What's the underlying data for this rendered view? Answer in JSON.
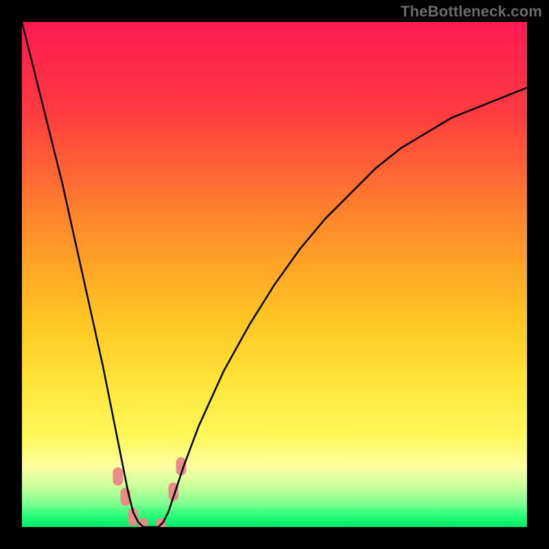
{
  "watermark": "TheBottleneck.com",
  "chart_data": {
    "type": "line",
    "title": "",
    "xlabel": "",
    "ylabel": "",
    "xlim": [
      0,
      100
    ],
    "ylim": [
      0,
      100
    ],
    "gradient_stops": [
      {
        "offset": 0,
        "color": "#ff1a54"
      },
      {
        "offset": 0.18,
        "color": "#ff3b3f"
      },
      {
        "offset": 0.4,
        "color": "#ff8a2a"
      },
      {
        "offset": 0.58,
        "color": "#ffc322"
      },
      {
        "offset": 0.72,
        "color": "#ffe63a"
      },
      {
        "offset": 0.82,
        "color": "#fff85a"
      },
      {
        "offset": 0.88,
        "color": "#fdffa0"
      },
      {
        "offset": 0.92,
        "color": "#c9ff9c"
      },
      {
        "offset": 0.955,
        "color": "#7dff90"
      },
      {
        "offset": 0.975,
        "color": "#2eff7a"
      },
      {
        "offset": 1.0,
        "color": "#00e96b"
      }
    ],
    "series": [
      {
        "name": "bottleneck-curve",
        "x": [
          0,
          2,
          4,
          6,
          8,
          10,
          12,
          14,
          16,
          18,
          20,
          21,
          22,
          23,
          24,
          25,
          26,
          27,
          28,
          29,
          30,
          32,
          35,
          40,
          45,
          50,
          55,
          60,
          65,
          70,
          75,
          80,
          85,
          90,
          95,
          100
        ],
        "y": [
          100,
          92,
          84,
          76,
          68,
          59,
          50,
          41,
          32,
          22,
          12,
          7,
          3,
          1,
          0,
          0,
          0,
          0,
          1,
          3,
          6,
          12,
          20,
          31,
          40,
          48,
          55,
          61,
          66,
          71,
          75,
          78,
          81,
          83,
          85,
          87
        ]
      }
    ],
    "markers": [
      {
        "x": 19.0,
        "y": 10,
        "color": "#e98b86"
      },
      {
        "x": 20.5,
        "y": 6,
        "color": "#e98b86"
      },
      {
        "x": 22.0,
        "y": 2,
        "color": "#e98b86"
      },
      {
        "x": 24.0,
        "y": 0,
        "color": "#e98b86"
      },
      {
        "x": 27.5,
        "y": 0,
        "color": "#e98b86"
      },
      {
        "x": 30.0,
        "y": 7,
        "color": "#e98b86"
      },
      {
        "x": 31.5,
        "y": 12,
        "color": "#e98b86"
      }
    ]
  }
}
